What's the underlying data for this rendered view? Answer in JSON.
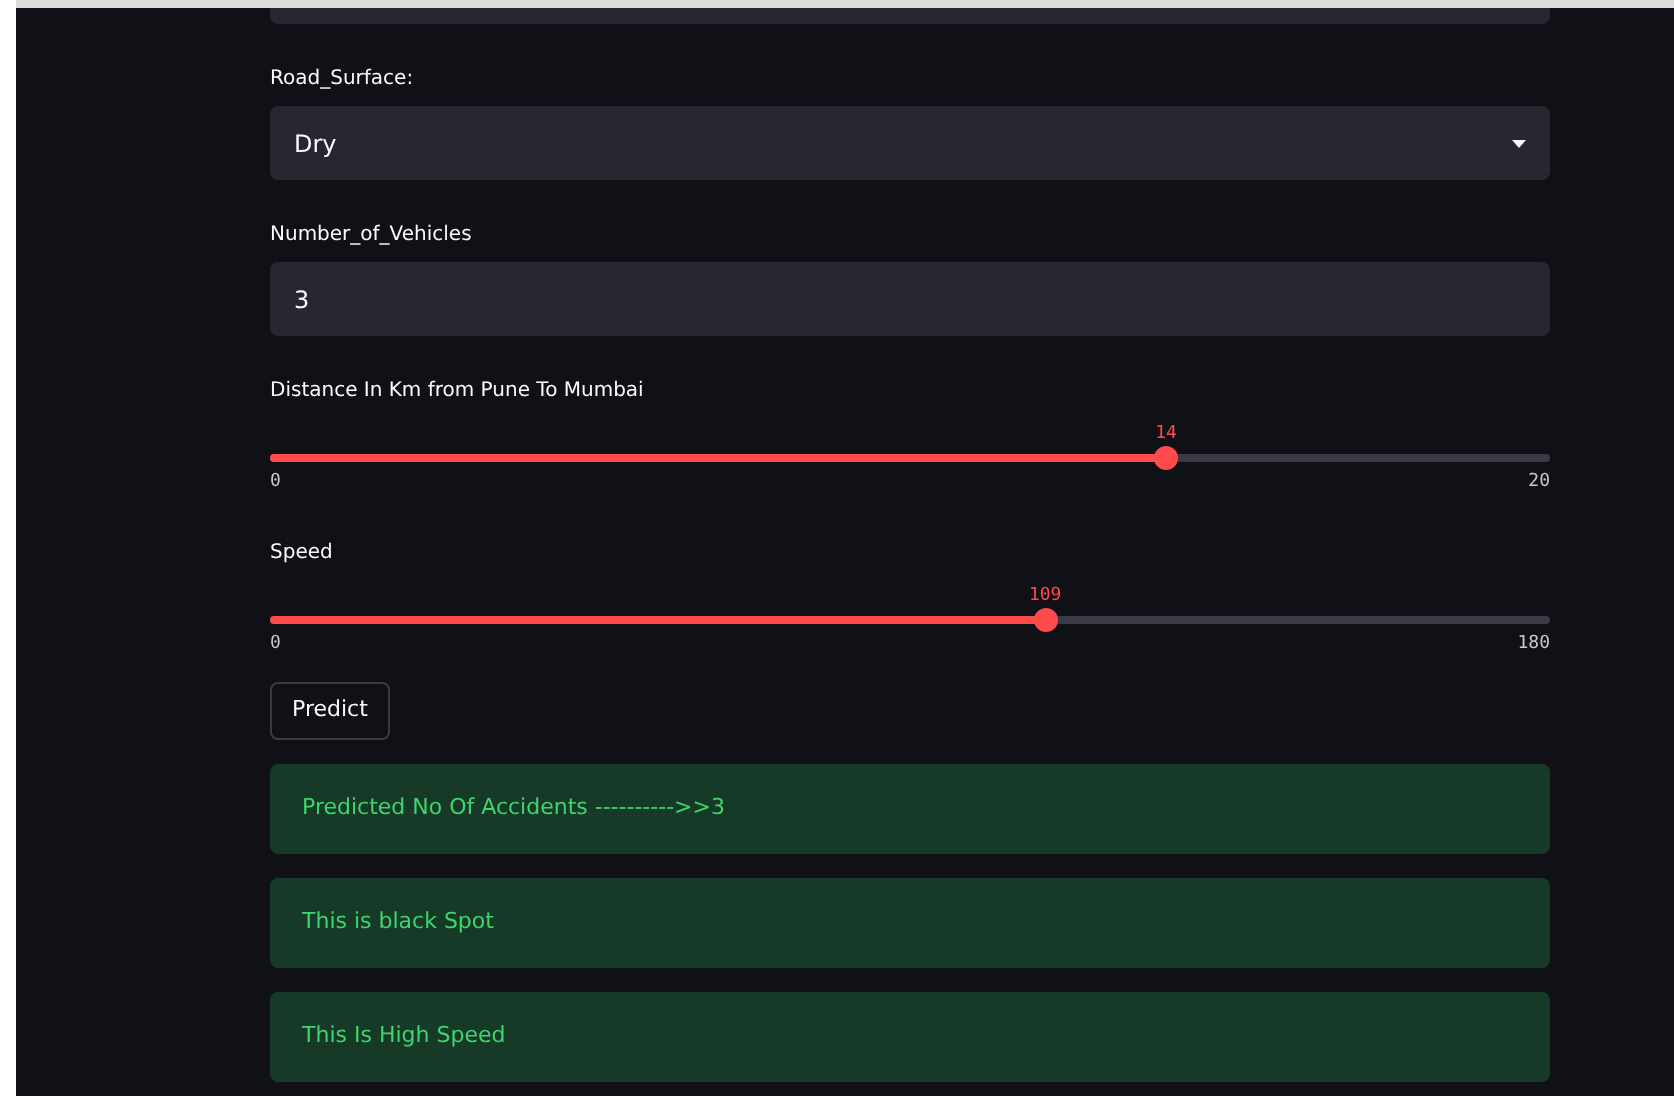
{
  "fields": [
    {
      "kind": "cut"
    },
    {
      "kind": "select",
      "label": "Road_Surface:",
      "value": "Dry"
    },
    {
      "kind": "number",
      "label": "Number_of_Vehicles",
      "value": "3"
    },
    {
      "kind": "slider",
      "label": "Distance In Km from Pune To Mumbai",
      "reading": "14",
      "min": "0",
      "max": "20",
      "level": 0.7
    },
    {
      "kind": "slider",
      "label": "Speed",
      "reading": "109",
      "min": "0",
      "max": "180",
      "level": 0.6056
    }
  ],
  "button": "Predict",
  "alerts": [
    "Predicted No Of Accidents ---------->>3",
    "This is black Spot",
    "This Is High Speed"
  ]
}
